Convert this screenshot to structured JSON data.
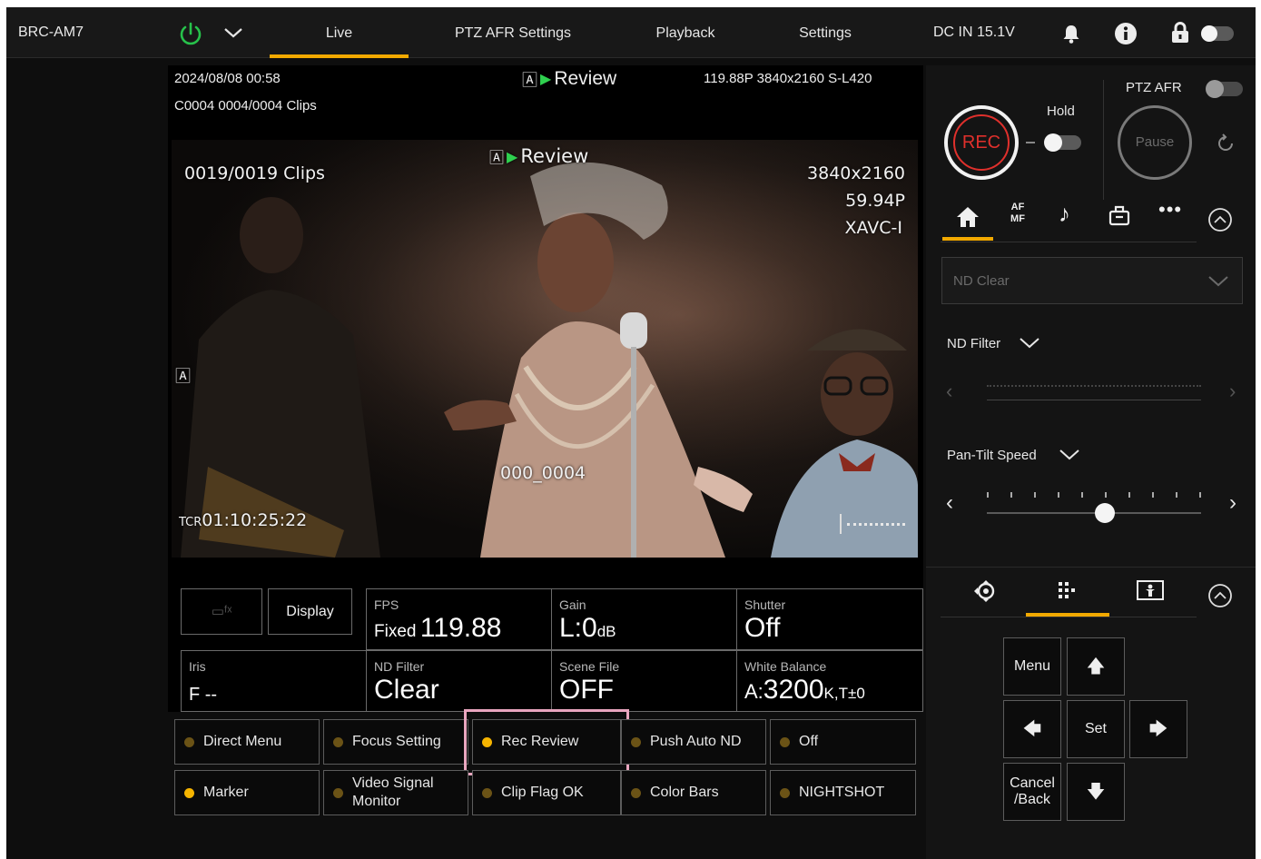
{
  "app": {
    "model": "BRC-AM7",
    "power_state": "on"
  },
  "tabs": [
    {
      "label": "Live",
      "active": true
    },
    {
      "label": "PTZ AFR Settings",
      "active": false
    },
    {
      "label": "Playback",
      "active": false
    },
    {
      "label": "Settings",
      "active": false
    }
  ],
  "status": {
    "power_input": "DC IN 15.1V"
  },
  "preview": {
    "date_time": "2024/08/08 00:58",
    "clip_info": "C0004  0004/0004 Clips",
    "mode": "Review",
    "format": "119.88P  3840x2160   S-L420"
  },
  "video": {
    "mode": "Review",
    "clips": "0019/0019 Clips",
    "resolution": "3840x2160",
    "frame_rate": "59.94P",
    "codec": "XAVC-I",
    "clip_name": "000_0004",
    "timecode_prefix": "TCR",
    "timecode": "01:10:25:22"
  },
  "grid": {
    "display_label": "Display",
    "fps": {
      "label": "FPS",
      "prefix": "Fixed",
      "value": "119.88"
    },
    "gain": {
      "label": "Gain",
      "value": "L:0",
      "unit": "dB"
    },
    "shutter": {
      "label": "Shutter",
      "value": "Off"
    },
    "iris": {
      "label": "Iris",
      "value": "F --"
    },
    "nd_filter": {
      "label": "ND Filter",
      "value": "Clear"
    },
    "scene_file": {
      "label": "Scene File",
      "value": "OFF"
    },
    "white_balance": {
      "label": "White Balance",
      "prefix": "A:",
      "value": "3200",
      "suffix": "K,T±0"
    }
  },
  "function_buttons": [
    {
      "label": "Direct Menu",
      "active": false
    },
    {
      "label": "Focus Setting",
      "active": false
    },
    {
      "label": "Rec Review",
      "active": true,
      "highlighted": true
    },
    {
      "label": "Push Auto ND",
      "active": false
    },
    {
      "label": "Off",
      "active": false
    },
    {
      "label": "Marker",
      "active": true
    },
    {
      "label": "Video Signal Monitor",
      "line1": "Video Signal",
      "line2": "Monitor",
      "active": false
    },
    {
      "label": "Clip Flag OK",
      "active": false
    },
    {
      "label": "Color Bars",
      "active": false
    },
    {
      "label": "NIGHTSHOT",
      "active": false
    }
  ],
  "right": {
    "rec_label": "REC",
    "hold_label": "Hold",
    "ptz_afr_label": "PTZ AFR",
    "pause_label": "Pause",
    "af_label_top": "AF",
    "af_label_bottom": "MF",
    "nd_dropdown": {
      "selected": "ND Clear"
    },
    "nd_filter_label": "ND Filter",
    "pan_tilt_label": "Pan-Tilt Speed",
    "pan_tilt_level": 0.55,
    "nav": {
      "menu": "Menu",
      "set": "Set",
      "cancel_line1": "Cancel",
      "cancel_line2": "/Back"
    }
  },
  "colors": {
    "accent": "#f2a900",
    "power": "#27c14b",
    "rec": "#e0302c",
    "highlight": "#e9a6bf"
  }
}
